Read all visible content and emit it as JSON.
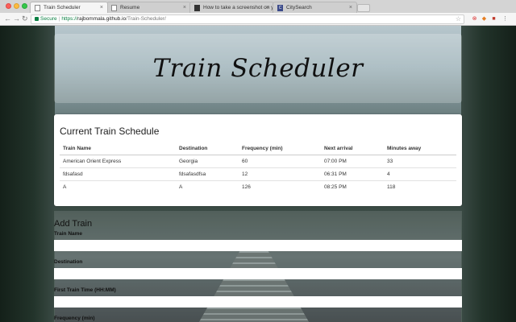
{
  "browser": {
    "tabs": [
      {
        "label": "Train Scheduler",
        "active": true,
        "favicon": "page-icon"
      },
      {
        "label": "Resume",
        "active": false,
        "favicon": "page-icon"
      },
      {
        "label": "How to take a screenshot on y",
        "active": false,
        "favicon": "apple-icon"
      },
      {
        "label": "CitySearch",
        "active": false,
        "favicon": "citysearch-icon"
      }
    ],
    "address": {
      "secure_label": "Secure",
      "protocol": "https://",
      "host": "rajbommala.github.io",
      "path": "/Train-Scheduler/"
    },
    "nav_icons": [
      "back-icon",
      "forward-icon",
      "reload-icon"
    ]
  },
  "header": {
    "title": "Train Scheduler"
  },
  "schedule": {
    "heading": "Current Train Schedule",
    "columns": [
      "Train Name",
      "Destination",
      "Frequency (min)",
      "Next arrival",
      "Minutes away"
    ],
    "rows": [
      [
        "American Orient Express",
        "Georgia",
        "60",
        "07:00 PM",
        "33"
      ],
      [
        "fdsafasd",
        "fdsafasdfsa",
        "12",
        "06:31 PM",
        "4"
      ],
      [
        "A",
        "A",
        "126",
        "08:25 PM",
        "118"
      ]
    ]
  },
  "form": {
    "heading": "Add Train",
    "fields": [
      {
        "label": "Train Name",
        "value": ""
      },
      {
        "label": "Destination",
        "value": ""
      },
      {
        "label": "First Train Time (HH:MM)",
        "value": ""
      },
      {
        "label": "Frequency (min)",
        "value": ""
      }
    ]
  },
  "colors": {
    "secure": "#0b8043",
    "panel_bg": "#ffffff"
  }
}
